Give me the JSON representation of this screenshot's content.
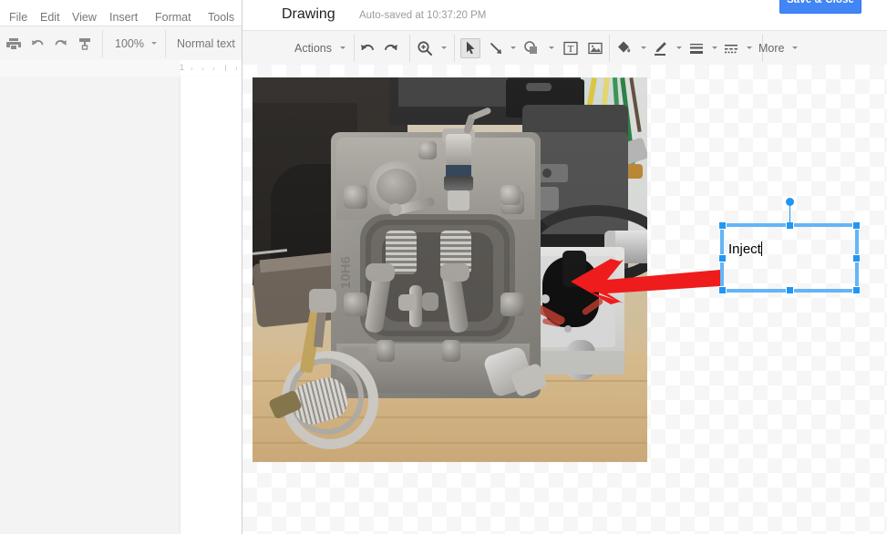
{
  "app": {
    "document_menus": [
      "File",
      "Edit",
      "View",
      "Insert",
      "Format",
      "Tools"
    ],
    "doc_toolbar": {
      "print_icon": "print-icon",
      "undo_icon": "undo-icon",
      "redo_icon": "redo-icon",
      "paint_format_icon": "paint-format-icon",
      "zoom_value": "100%",
      "style_value": "Normal text"
    },
    "ruler": {
      "marker": "1"
    }
  },
  "dialog": {
    "title": "Drawing",
    "autosave": "Auto-saved at 10:37:20 PM",
    "save_button": "Save & Close",
    "toolbar": {
      "actions_label": "Actions",
      "more_label": "More",
      "undo_icon": "undo-icon",
      "redo_icon": "redo-icon",
      "zoom_icon": "zoom-in-icon",
      "select_icon": "select-arrow-icon",
      "line_icon": "line-icon",
      "shape_icon": "shape-icon",
      "textbox_icon": "text-box-icon",
      "image_icon": "image-icon",
      "fill_icon": "fill-color-icon",
      "line_color_icon": "line-color-icon",
      "line_weight_icon": "line-weight-icon",
      "line_dash_icon": "line-dash-icon"
    },
    "canvas": {
      "image_alt": "small-engine-photo",
      "arrow": {
        "color": "#ee1c1c",
        "direction": "left"
      },
      "textbox": {
        "text": "Inject",
        "selected": true,
        "border_color": "#17a0e8",
        "handle_color": "#2196f3"
      }
    }
  },
  "colors": {
    "accent_blue": "#4285f4",
    "selection_blue": "#2196f3",
    "arrow_red": "#ee1c1c",
    "toolbar_bg": "#f5f5f5"
  }
}
